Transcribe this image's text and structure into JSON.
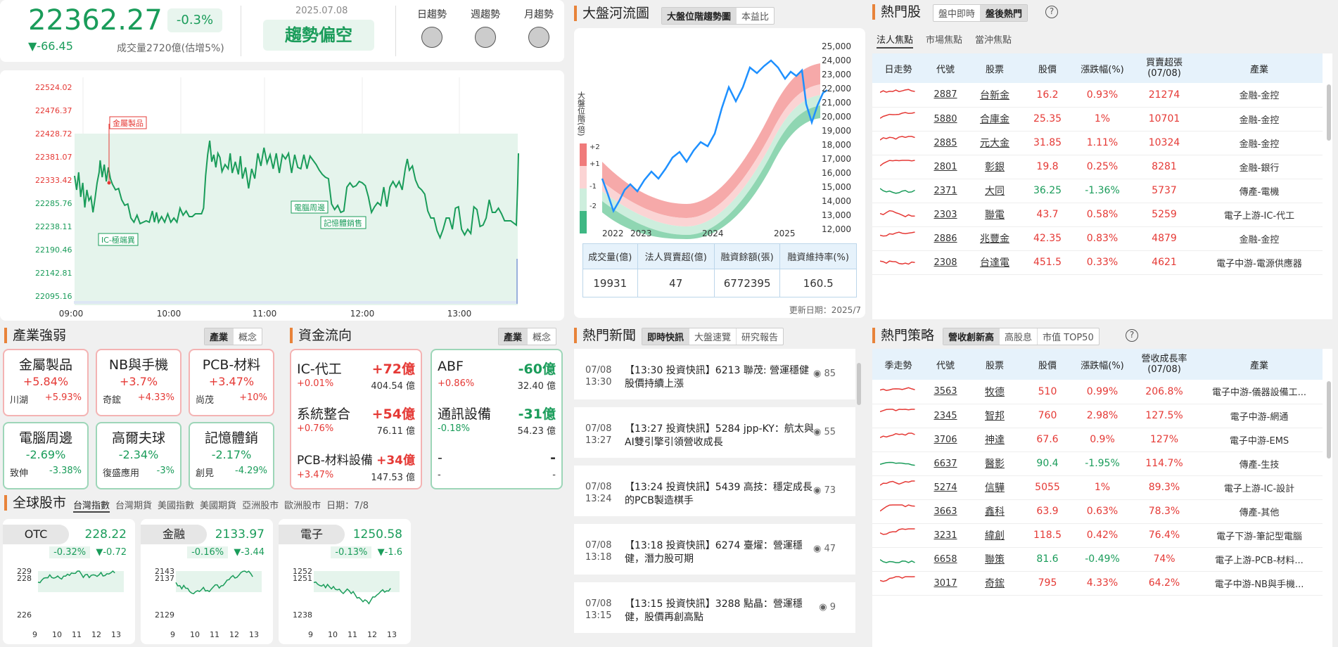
{
  "index": {
    "value": "22362.27",
    "pct": "-0.3%",
    "change": "▼-66.45",
    "volume": "成交量2720億(估增5%)",
    "date": "2025.07.08",
    "trend": "趨勢偏空",
    "trend_labels": [
      "日趨勢",
      "週趨勢",
      "月趨勢"
    ]
  },
  "intraday": {
    "y_ticks": [
      "22524.02",
      "22476.37",
      "22428.72",
      "22381.07",
      "22333.42",
      "22285.76",
      "22238.11",
      "22190.46",
      "22142.81",
      "22095.16"
    ],
    "x_ticks": [
      "09:00",
      "10:00",
      "11:00",
      "12:00",
      "13:00"
    ],
    "annotations": [
      "金屬製品",
      "電腦周邊",
      "記憶體銷售",
      "IC-極端異"
    ]
  },
  "river": {
    "title": "大盤河流圖",
    "tabs": [
      "大盤位階趨勢圖",
      "本益比"
    ],
    "y_ticks": [
      "25,000",
      "24,000",
      "23,000",
      "22,000",
      "21,000",
      "20,000",
      "19,000",
      "18,000",
      "17,000",
      "16,000",
      "15,000",
      "14,000",
      "13,000",
      "12,000"
    ],
    "x_ticks": [
      "2022",
      "2023",
      "2024",
      "2025"
    ],
    "level_label": "大盤位階(倍)",
    "levels": [
      "+2",
      "+1",
      "-1",
      "-2"
    ],
    "stats_headers": [
      "成交量(億)",
      "法人買賣超(億)",
      "融資餘額(張)",
      "融資維持率(%)"
    ],
    "stats_values": [
      "19931",
      "47",
      "6772395",
      "160.5"
    ],
    "updated": "更新日期：2025/7"
  },
  "hot": {
    "title": "熱門股",
    "tabs": [
      "盤中即時",
      "盤後熱門"
    ],
    "subtabs": [
      "法人焦點",
      "市場焦點",
      "當沖焦點"
    ],
    "headers": [
      "日走勢",
      "代號",
      "股票",
      "股價",
      "漲跌幅(%)",
      "買賣超張\n(07/08)",
      "產業"
    ],
    "rows": [
      {
        "code": "2887",
        "name": "台新金",
        "price": "16.2",
        "pct": "0.93%",
        "amt": "21274",
        "ind": "金融-金控",
        "up": true
      },
      {
        "code": "5880",
        "name": "合庫金",
        "price": "25.35",
        "pct": "1%",
        "amt": "10701",
        "ind": "金融-金控",
        "up": true
      },
      {
        "code": "2885",
        "name": "元大金",
        "price": "31.85",
        "pct": "1.11%",
        "amt": "10324",
        "ind": "金融-金控",
        "up": true
      },
      {
        "code": "2801",
        "name": "彰銀",
        "price": "19.8",
        "pct": "0.25%",
        "amt": "8281",
        "ind": "金融-銀行",
        "up": true
      },
      {
        "code": "2371",
        "name": "大同",
        "price": "36.25",
        "pct": "-1.36%",
        "amt": "5737",
        "ind": "傳產-電機",
        "up": false
      },
      {
        "code": "2303",
        "name": "聯電",
        "price": "43.7",
        "pct": "0.58%",
        "amt": "5259",
        "ind": "電子上游-IC-代工",
        "up": true
      },
      {
        "code": "2886",
        "name": "兆豐金",
        "price": "42.35",
        "pct": "0.83%",
        "amt": "4879",
        "ind": "金融-金控",
        "up": true
      },
      {
        "code": "2308",
        "name": "台達電",
        "price": "451.5",
        "pct": "0.33%",
        "amt": "4621",
        "ind": "電子中游-電源供應器",
        "up": true
      }
    ]
  },
  "industry": {
    "title": "產業強弱",
    "tabs": [
      "產業",
      "概念"
    ],
    "cards": [
      {
        "name": "金屬製品",
        "pct": "+5.84%",
        "sub": "川湖",
        "subpct": "+5.93%",
        "up": true
      },
      {
        "name": "NB與手機",
        "pct": "+3.7%",
        "sub": "奇鋐",
        "subpct": "+4.33%",
        "up": true
      },
      {
        "name": "PCB-材料",
        "pct": "+3.47%",
        "sub": "尚茂",
        "subpct": "+10%",
        "up": true
      },
      {
        "name": "電腦周邊",
        "pct": "-2.69%",
        "sub": "致伸",
        "subpct": "-3.38%",
        "up": false
      },
      {
        "name": "高爾夫球",
        "pct": "-2.34%",
        "sub": "復盛應用",
        "subpct": "-3%",
        "up": false
      },
      {
        "name": "記憶體銷",
        "pct": "-2.17%",
        "sub": "創見",
        "subpct": "-4.29%",
        "up": false
      }
    ]
  },
  "fund": {
    "title": "資金流向",
    "tabs": [
      "產業",
      "概念"
    ],
    "left": [
      {
        "name": "IC-代工",
        "val": "+72億",
        "pct": "+0.01%",
        "amt": "404.54 億"
      },
      {
        "name": "系統整合",
        "val": "+54億",
        "pct": "+0.76%",
        "amt": "76.11 億"
      },
      {
        "name": "PCB-材料設備",
        "val": "+34億",
        "pct": "+3.47%",
        "amt": "147.53 億"
      }
    ],
    "right": [
      {
        "name": "ABF",
        "val": "-60億",
        "pct": "+0.86%",
        "amt": "32.40 億"
      },
      {
        "name": "通訊設備",
        "val": "-31億",
        "pct": "-0.18%",
        "amt": "54.23 億"
      },
      {
        "name": "-",
        "val": "-",
        "pct": "-",
        "amt": "-"
      }
    ]
  },
  "news": {
    "title": "熱門新聞",
    "tabs": [
      "即時快訊",
      "大盤速覽",
      "研究報告"
    ],
    "items": [
      {
        "date": "07/08",
        "time": "13:30",
        "text": "【13:30 投資快訊】6213 聯茂: 營運穩健 股價持續上漲",
        "views": "85"
      },
      {
        "date": "07/08",
        "time": "13:27",
        "text": "【13:27 投資快訊】5284 jpp-KY：航太與AI雙引擎引領營收成長",
        "views": "55"
      },
      {
        "date": "07/08",
        "time": "13:24",
        "text": "【13:24 投資快訊】5439 高技：穩定成長的PCB製造棋手",
        "views": "73"
      },
      {
        "date": "07/08",
        "time": "13:18",
        "text": "【13:18 投資快訊】6274 臺燿：營運穩健，潛力股可期",
        "views": "47"
      },
      {
        "date": "07/08",
        "time": "13:15",
        "text": "【13:15 投資快訊】3288 點晶：營運穩健，股價再創高點",
        "views": "9"
      }
    ]
  },
  "strategy": {
    "title": "熱門策略",
    "tabs": [
      "營收創新高",
      "高股息",
      "市值 TOP50"
    ],
    "headers": [
      "季走勢",
      "代號",
      "股票",
      "股價",
      "漲跌幅(%)",
      "營收成長率\n(07/08)",
      "產業"
    ],
    "rows": [
      {
        "code": "3563",
        "name": "牧德",
        "price": "510",
        "pct": "0.99%",
        "amt": "206.8%",
        "ind": "電子中游-儀器設備工...",
        "up": true
      },
      {
        "code": "2345",
        "name": "智邦",
        "price": "760",
        "pct": "2.98%",
        "amt": "127.5%",
        "ind": "電子中游-網通",
        "up": true
      },
      {
        "code": "3706",
        "name": "神達",
        "price": "67.6",
        "pct": "0.9%",
        "amt": "127%",
        "ind": "電子中游-EMS",
        "up": true
      },
      {
        "code": "6637",
        "name": "醫影",
        "price": "90.4",
        "pct": "-1.95%",
        "amt": "114.7%",
        "ind": "傳產-生技",
        "up": false
      },
      {
        "code": "5274",
        "name": "信驊",
        "price": "5055",
        "pct": "1%",
        "amt": "89.3%",
        "ind": "電子上游-IC-設計",
        "up": true
      },
      {
        "code": "3663",
        "name": "鑫科",
        "price": "63.9",
        "pct": "0.63%",
        "amt": "78.3%",
        "ind": "傳產-其他",
        "up": true
      },
      {
        "code": "3231",
        "name": "緯創",
        "price": "118.5",
        "pct": "0.42%",
        "amt": "76.4%",
        "ind": "電子下游-筆記型電腦",
        "up": true
      },
      {
        "code": "6658",
        "name": "聯策",
        "price": "81.6",
        "pct": "-0.49%",
        "amt": "74%",
        "ind": "電子上游-PCB-材料...",
        "up": false
      },
      {
        "code": "3017",
        "name": "奇鋐",
        "price": "795",
        "pct": "4.33%",
        "amt": "64.2%",
        "ind": "電子中游-NB與手機...",
        "up": true
      }
    ]
  },
  "global": {
    "title": "全球股市",
    "tabs": [
      "台灣指數",
      "台灣期貨",
      "美國指數",
      "美國期貨",
      "亞洲股市",
      "歐洲股市"
    ],
    "date": "日期：7/8",
    "cards": [
      {
        "name": "OTC",
        "val": "228.22",
        "pct": "-0.32%",
        "chg": "▼-0.72",
        "y_ticks": [
          "229",
          "228",
          "226"
        ],
        "x_ticks": [
          "9",
          "10",
          "11",
          "12",
          "13"
        ]
      },
      {
        "name": "金融",
        "val": "2133.97",
        "pct": "-0.16%",
        "chg": "▼-3.44",
        "y_ticks": [
          "2143",
          "2137",
          "2129"
        ],
        "x_ticks": [
          "9",
          "10",
          "11",
          "12",
          "13"
        ]
      },
      {
        "name": "電子",
        "val": "1250.58",
        "pct": "-0.13%",
        "chg": "▼-1.6",
        "y_ticks": [
          "1252",
          "1251",
          "1238"
        ],
        "x_ticks": [
          "9",
          "10",
          "11",
          "12",
          "13"
        ]
      }
    ]
  },
  "colors": {
    "up": "#e53935",
    "down": "#1a9c5a",
    "accent": "#e8833a",
    "header_bg": "#e6f2fb"
  }
}
